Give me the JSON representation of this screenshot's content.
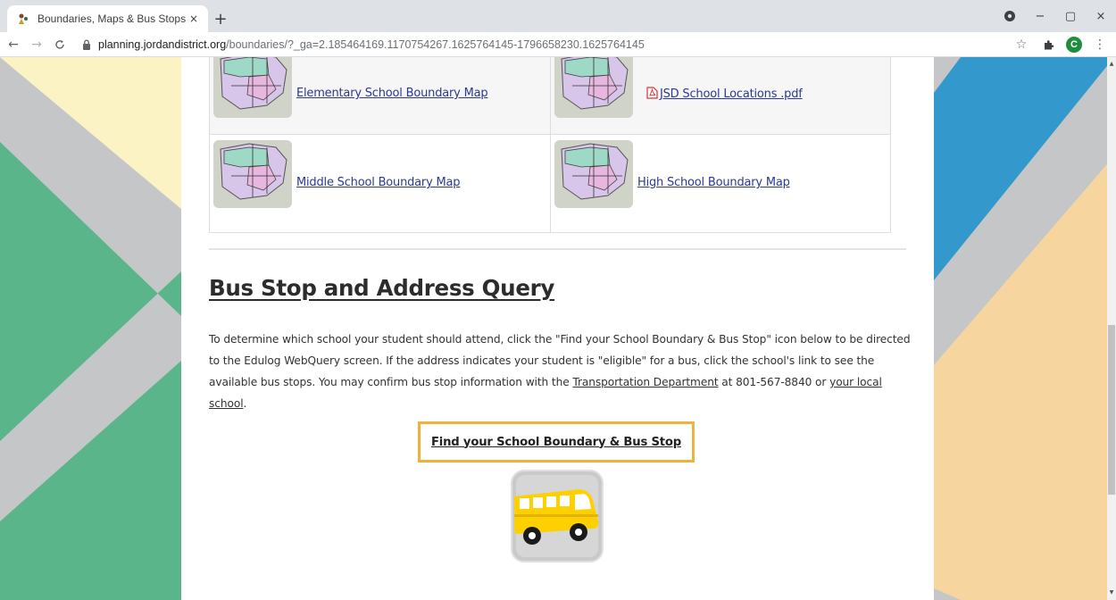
{
  "browser": {
    "tab_title": "Boundaries, Maps & Bus Stops -",
    "tab_close": "×",
    "new_tab": "+",
    "url_host": "planning.jordandistrict.org",
    "url_path": "/boundaries/?_ga=2.185464169.1170754267.1625764145-1796658230.1625764145",
    "profile_initial": "C",
    "win_minimize": "−",
    "win_maximize": "▢",
    "win_close": "×"
  },
  "maps": {
    "elementary_link": "Elementary School Boundary Map",
    "locations_link": "JSD School Locations .pdf",
    "middle_link": "Middle School Boundary Map",
    "high_link": "High School Boundary Map"
  },
  "bus_section": {
    "title": "Bus Stop and Address Query",
    "para_part1": "To determine which school your student should attend, click the \"Find your School Boundary & Bus Stop\" icon below to be directed to the Edulog WebQuery screen.  If the address indicates your student is \"eligible\" for a bus, click the school's link to see the available bus stops. You may confirm bus stop information with the ",
    "transport_link": "Transportation Department",
    "para_part2": " at 801-567-8840 or ",
    "local_school_link": "your local school",
    "para_part3": ".",
    "find_button": "Find your School Boundary & Bus Stop"
  },
  "colors": {
    "link": "#2b3990",
    "button_border": "#f0b23c",
    "bg_green": "#5bb58a",
    "bg_gray": "#c4c6c8",
    "bg_yellow": "#fcf3c4",
    "bg_blue": "#3399cc",
    "bg_tan": "#f6d59e"
  }
}
